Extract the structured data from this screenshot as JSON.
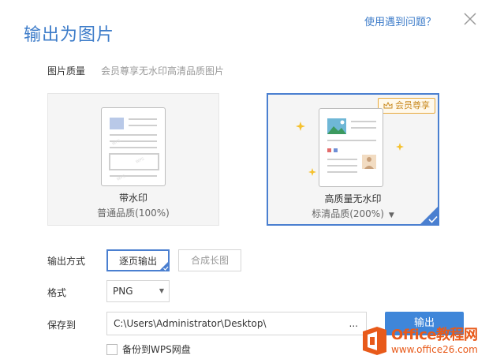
{
  "dialog": {
    "title": "输出为图片",
    "help_link": "使用遇到问题？"
  },
  "quality": {
    "label": "图片质量",
    "description": "会员尊享无水印高清品质图片",
    "options": [
      {
        "title": "带水印",
        "subtitle": "普通品质(100%)"
      },
      {
        "title": "高质量无水印",
        "subtitle": "标清品质(200%)",
        "badge": "会员尊享",
        "selected": true
      }
    ]
  },
  "output_mode": {
    "label": "输出方式",
    "options": [
      "逐页输出",
      "合成长图"
    ],
    "selected": "逐页输出"
  },
  "format": {
    "label": "格式",
    "value": "PNG"
  },
  "save_to": {
    "label": "保存到",
    "path": "C:\\Users\\Administrator\\Desktop\\",
    "browse_label": "...",
    "export_button": "输出"
  },
  "backup": {
    "label": "备份到WPS网盘",
    "checked": false
  },
  "watermark": {
    "line1": "Office教程网",
    "line2": "www.office26.com"
  },
  "colors": {
    "accent": "#3d7cc9",
    "button": "#3f86d9",
    "vip": "#e7a93c",
    "watermark": "#e85a1a"
  }
}
